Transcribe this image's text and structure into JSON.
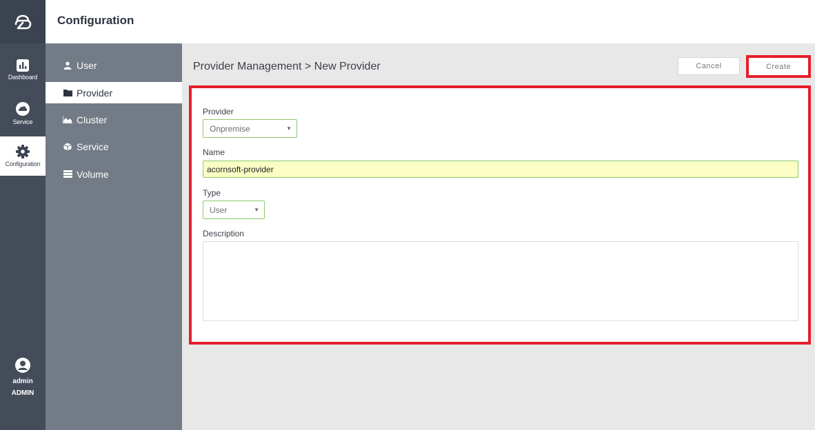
{
  "header": {
    "title": "Configuration"
  },
  "rail": {
    "items": [
      {
        "label": "Dashboard",
        "icon": "bar-chart-icon"
      },
      {
        "label": "Service",
        "icon": "cloud-icon"
      },
      {
        "label": "Configuration",
        "icon": "gear-icon"
      }
    ],
    "user": {
      "name": "admin",
      "role": "ADMIN"
    }
  },
  "subnav": {
    "items": [
      {
        "label": "User",
        "icon": "user-icon"
      },
      {
        "label": "Provider",
        "icon": "folder-icon"
      },
      {
        "label": "Cluster",
        "icon": "area-chart-icon"
      },
      {
        "label": "Service",
        "icon": "cube-icon"
      },
      {
        "label": "Volume",
        "icon": "server-icon"
      }
    ]
  },
  "main": {
    "breadcrumb": "Provider Management > New Provider",
    "cancel_label": "Cancel",
    "create_label": "Create",
    "form": {
      "provider_label": "Provider",
      "provider_value": "Onpremise",
      "name_label": "Name",
      "name_value": "acornsoft-provider",
      "type_label": "Type",
      "type_value": "User",
      "description_label": "Description",
      "description_value": ""
    }
  },
  "colors": {
    "highlight": "#e41e2a",
    "rail": "#444c59",
    "subnav": "#737b86",
    "field_border": "#8cc96b"
  }
}
